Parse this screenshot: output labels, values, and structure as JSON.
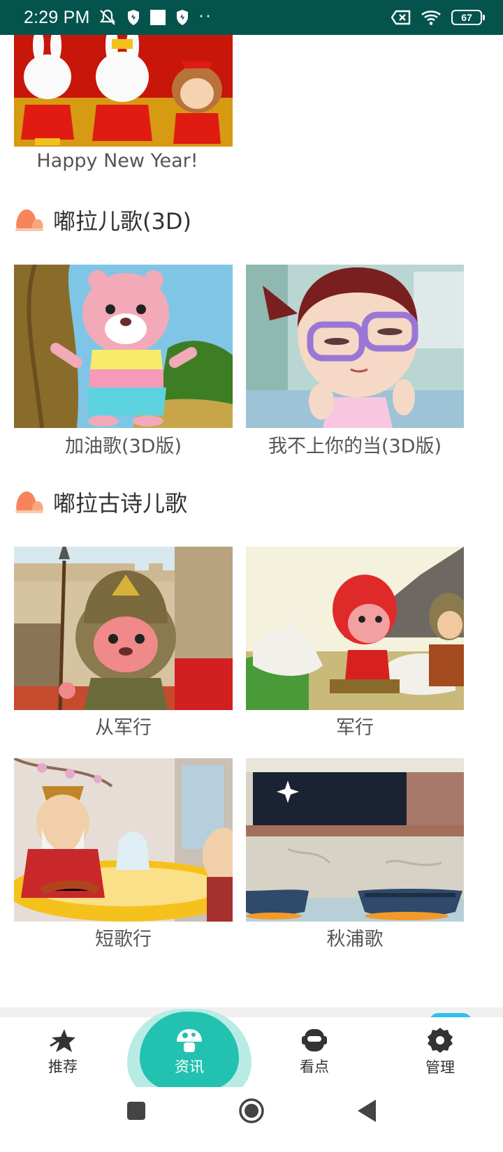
{
  "status_bar": {
    "time": "2:29 PM",
    "battery": "67",
    "icons": [
      "muted-bell-icon",
      "shield-icon",
      "square-icon",
      "shield-icon",
      "more-dots-icon",
      "sim-off-icon",
      "wifi-icon",
      "battery-icon"
    ]
  },
  "top_item": {
    "caption": "Happy New Year!"
  },
  "sections": [
    {
      "title": "嘟拉儿歌(3D)",
      "items": [
        {
          "caption": "加油歌(3D版)"
        },
        {
          "caption": "我不上你的当(3D版)"
        }
      ]
    },
    {
      "title": "嘟拉古诗儿歌",
      "items": [
        {
          "caption": "从军行"
        },
        {
          "caption": "军行"
        },
        {
          "caption": "短歌行"
        },
        {
          "caption": "秋浦歌"
        }
      ]
    }
  ],
  "bottom_nav": {
    "items": [
      {
        "label": "推荐",
        "icon": "star-icon"
      },
      {
        "label": "资讯",
        "icon": "mushroom-icon",
        "active": true
      },
      {
        "label": "看点",
        "icon": "robot-icon"
      },
      {
        "label": "管理",
        "icon": "gear-icon"
      }
    ]
  },
  "colors": {
    "status_bar": "#04544d",
    "accent": "#22c1b0",
    "accent_light": "#b9ebe5",
    "section_icon": "#f7845a"
  }
}
